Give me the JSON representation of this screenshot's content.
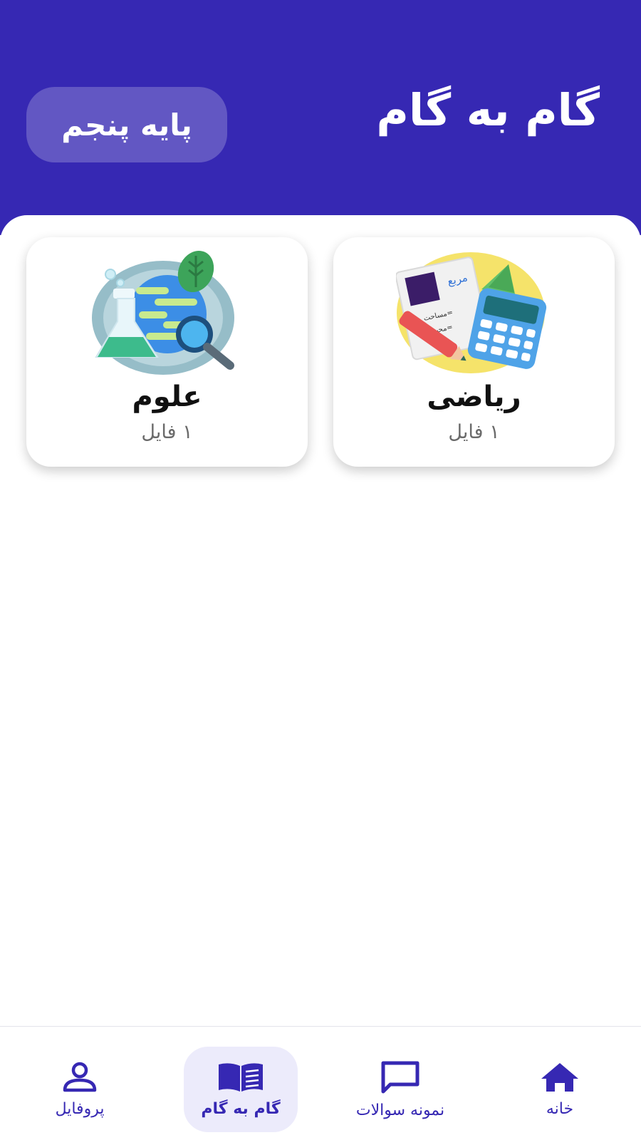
{
  "header": {
    "title": "گام به گام",
    "grade_label": "پایه پنجم",
    "background_color": "#3628b3"
  },
  "subjects": [
    {
      "title": "ریاضی",
      "count": "۱ فایل",
      "icon": "math-icon",
      "illustration_text": {
        "square": "مربع",
        "area": "=مساحت",
        "perimeter": "=محیط"
      }
    },
    {
      "title": "علوم",
      "count": "۱ فایل",
      "icon": "science-icon"
    }
  ],
  "bottom_nav": {
    "accent_color": "#3628b3",
    "items": [
      {
        "label": "خانه",
        "icon": "home-icon",
        "active": false
      },
      {
        "label": "نمونه سوالات",
        "icon": "chat-icon",
        "active": false
      },
      {
        "label": "گام به گام",
        "icon": "book-icon",
        "active": true
      },
      {
        "label": "پروفایل",
        "icon": "user-icon",
        "active": false
      }
    ]
  }
}
